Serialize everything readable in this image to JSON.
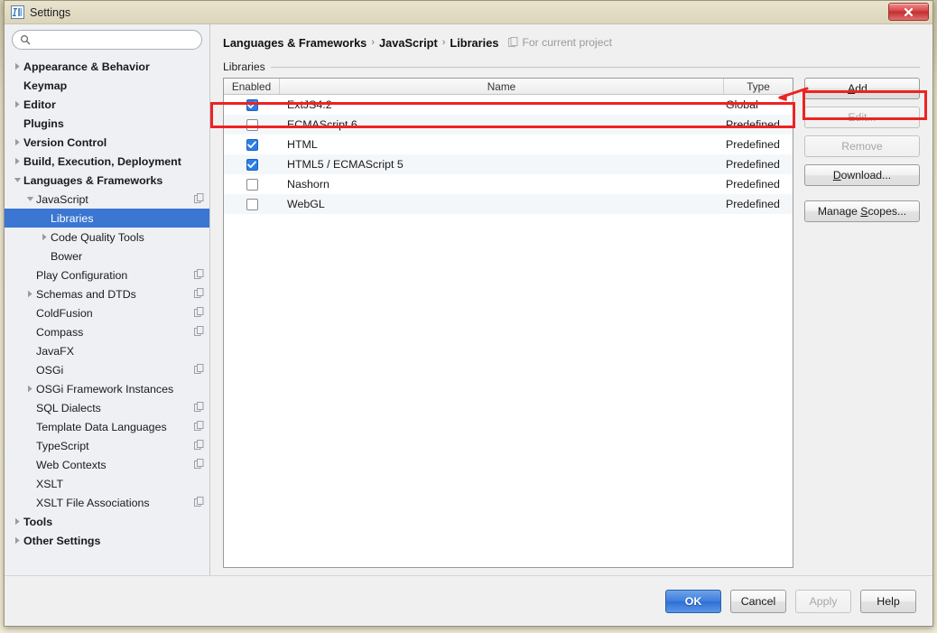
{
  "window": {
    "title": "Settings",
    "app_icon": "intellij-logo-icon",
    "close_label": "✕"
  },
  "search": {
    "value": "",
    "placeholder": "",
    "icon": "search-icon"
  },
  "sidebar": {
    "items": [
      {
        "label": "Appearance & Behavior",
        "level": 0,
        "bold": true,
        "twisty": "right",
        "scope_icon": false,
        "selected": false
      },
      {
        "label": "Keymap",
        "level": 0,
        "bold": true,
        "twisty": "none",
        "scope_icon": false,
        "selected": false
      },
      {
        "label": "Editor",
        "level": 0,
        "bold": true,
        "twisty": "right",
        "scope_icon": false,
        "selected": false
      },
      {
        "label": "Plugins",
        "level": 0,
        "bold": true,
        "twisty": "none",
        "scope_icon": false,
        "selected": false
      },
      {
        "label": "Version Control",
        "level": 0,
        "bold": true,
        "twisty": "right",
        "scope_icon": false,
        "selected": false
      },
      {
        "label": "Build, Execution, Deployment",
        "level": 0,
        "bold": true,
        "twisty": "right",
        "scope_icon": false,
        "selected": false
      },
      {
        "label": "Languages & Frameworks",
        "level": 0,
        "bold": true,
        "twisty": "down",
        "scope_icon": false,
        "selected": false
      },
      {
        "label": "JavaScript",
        "level": 1,
        "bold": false,
        "twisty": "down",
        "scope_icon": true,
        "selected": false
      },
      {
        "label": "Libraries",
        "level": 2,
        "bold": false,
        "twisty": "none",
        "scope_icon": false,
        "selected": true
      },
      {
        "label": "Code Quality Tools",
        "level": 2,
        "bold": false,
        "twisty": "right",
        "scope_icon": false,
        "selected": false
      },
      {
        "label": "Bower",
        "level": 2,
        "bold": false,
        "twisty": "none",
        "scope_icon": false,
        "selected": false
      },
      {
        "label": "Play Configuration",
        "level": 1,
        "bold": false,
        "twisty": "none",
        "scope_icon": true,
        "selected": false
      },
      {
        "label": "Schemas and DTDs",
        "level": 1,
        "bold": false,
        "twisty": "right",
        "scope_icon": true,
        "selected": false
      },
      {
        "label": "ColdFusion",
        "level": 1,
        "bold": false,
        "twisty": "none",
        "scope_icon": true,
        "selected": false
      },
      {
        "label": "Compass",
        "level": 1,
        "bold": false,
        "twisty": "none",
        "scope_icon": true,
        "selected": false
      },
      {
        "label": "JavaFX",
        "level": 1,
        "bold": false,
        "twisty": "none",
        "scope_icon": false,
        "selected": false
      },
      {
        "label": "OSGi",
        "level": 1,
        "bold": false,
        "twisty": "none",
        "scope_icon": true,
        "selected": false
      },
      {
        "label": "OSGi Framework Instances",
        "level": 1,
        "bold": false,
        "twisty": "right",
        "scope_icon": false,
        "selected": false
      },
      {
        "label": "SQL Dialects",
        "level": 1,
        "bold": false,
        "twisty": "none",
        "scope_icon": true,
        "selected": false
      },
      {
        "label": "Template Data Languages",
        "level": 1,
        "bold": false,
        "twisty": "none",
        "scope_icon": true,
        "selected": false
      },
      {
        "label": "TypeScript",
        "level": 1,
        "bold": false,
        "twisty": "none",
        "scope_icon": true,
        "selected": false
      },
      {
        "label": "Web Contexts",
        "level": 1,
        "bold": false,
        "twisty": "none",
        "scope_icon": true,
        "selected": false
      },
      {
        "label": "XSLT",
        "level": 1,
        "bold": false,
        "twisty": "none",
        "scope_icon": false,
        "selected": false
      },
      {
        "label": "XSLT File Associations",
        "level": 1,
        "bold": false,
        "twisty": "none",
        "scope_icon": true,
        "selected": false
      },
      {
        "label": "Tools",
        "level": 0,
        "bold": true,
        "twisty": "right",
        "scope_icon": false,
        "selected": false
      },
      {
        "label": "Other Settings",
        "level": 0,
        "bold": true,
        "twisty": "right",
        "scope_icon": false,
        "selected": false
      }
    ]
  },
  "main": {
    "breadcrumb": {
      "parts": [
        "Languages & Frameworks",
        "JavaScript",
        "Libraries"
      ],
      "separator": "›",
      "scope_note": "For current project",
      "scope_note_icon": "project-scope-icon"
    },
    "group_label": "Libraries",
    "table": {
      "columns": [
        "Enabled",
        "Name",
        "Type"
      ],
      "rows": [
        {
          "enabled": true,
          "name": "ExtJS4.2",
          "type": "Global"
        },
        {
          "enabled": false,
          "name": "ECMAScript 6",
          "type": "Predefined"
        },
        {
          "enabled": true,
          "name": "HTML",
          "type": "Predefined"
        },
        {
          "enabled": true,
          "name": "HTML5 / ECMAScript 5",
          "type": "Predefined"
        },
        {
          "enabled": false,
          "name": "Nashorn",
          "type": "Predefined"
        },
        {
          "enabled": false,
          "name": "WebGL",
          "type": "Predefined"
        }
      ]
    },
    "side_buttons": [
      {
        "label": "Add...",
        "mnemonic": "A",
        "disabled": false
      },
      {
        "label": "Edit...",
        "mnemonic": "E",
        "disabled": true
      },
      {
        "label": "Remove",
        "mnemonic": "R",
        "disabled": true
      },
      {
        "label": "Download...",
        "mnemonic": "D",
        "disabled": false
      },
      {
        "label": "Manage Scopes...",
        "mnemonic": "S",
        "disabled": false
      }
    ]
  },
  "footer": {
    "buttons": [
      {
        "label": "OK",
        "primary": true,
        "disabled": false
      },
      {
        "label": "Cancel",
        "primary": false,
        "disabled": false
      },
      {
        "label": "Apply",
        "primary": false,
        "disabled": true
      },
      {
        "label": "Help",
        "primary": false,
        "disabled": false
      }
    ]
  },
  "annotations": {
    "color": "#ee2222",
    "highlight_row": "ExtJS4.2",
    "highlight_button": "Add...",
    "arrow": "red-arrow-icon"
  },
  "colors": {
    "selection_blue": "#3a76d2",
    "checkbox_blue": "#2a7fe8",
    "primary_button_blue": "#3f7fdd",
    "annotation_red": "#ee2222",
    "sidebar_bg": "#eef0f4"
  }
}
